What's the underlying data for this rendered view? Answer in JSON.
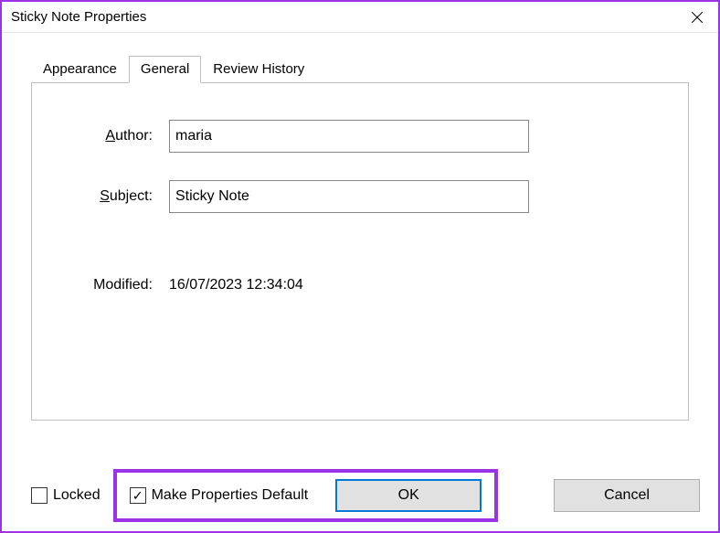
{
  "window": {
    "title": "Sticky Note Properties"
  },
  "tabs": {
    "appearance": "Appearance",
    "general": "General",
    "reviewHistory": "Review History"
  },
  "form": {
    "authorLabel": "uthor:",
    "authorValue": "maria",
    "subjectLabel": "ubject:",
    "subjectValue": "Sticky Note",
    "modifiedLabel": "Modified:",
    "modifiedValue": "16/07/2023 12:34:04"
  },
  "footer": {
    "lockedLabel": "Locked",
    "lockedChecked": false,
    "makeDefaultLabel": "Make Properties Default",
    "makeDefaultChecked": true,
    "okLabel": "OK",
    "cancelLabel": "Cancel"
  }
}
